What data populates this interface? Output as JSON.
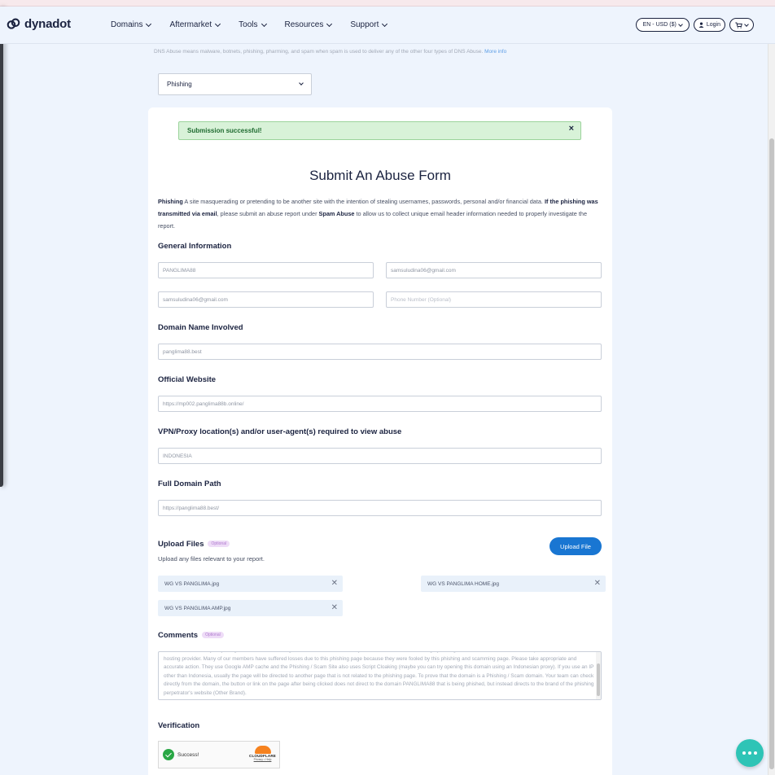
{
  "header": {
    "logo_text": "dynadot",
    "nav": [
      "Domains",
      "Aftermarket",
      "Tools",
      "Resources",
      "Support"
    ],
    "locale": "EN - USD ($)",
    "login": "Login"
  },
  "intro_note": "DNS Abuse means malware, botnets, phishing, pharming, and spam when spam is used to deliver any of the other four types of DNS Abuse.",
  "more_info": "More info",
  "abuse_type": "Phishing",
  "alert": {
    "text": "Submission successful!",
    "close": "×"
  },
  "form": {
    "title": "Submit An Abuse Form",
    "desc": {
      "term": "Phishing",
      "text1": " A site masquerading or pretending to be another site with the intention of stealing usernames, passwords, personal and/or financial data. ",
      "bold1": "If the phishing was transmitted via email",
      "text2": ", please submit an abuse report under ",
      "bold2": "Spam Abuse",
      "text3": " to allow us to collect unique email header information needed to properly investigate the report."
    },
    "general_info_label": "General Information",
    "name_value": "PANGLIMA88",
    "email_value": "samsuludina06@gmail.com",
    "email_confirm_value": "samsuludina06@gmail.com",
    "phone_placeholder": "Phone Number (Optional)",
    "domain_label": "Domain Name Involved",
    "domain_value": "panglima88.best",
    "website_label": "Official Website",
    "website_value": "https://mp002.panglima88b.online/",
    "vpn_label": "VPN/Proxy location(s) and/or user-agent(s) required to view abuse",
    "vpn_value": "INDONESIA",
    "path_label": "Full Domain Path",
    "path_value": "https://panglima88.best/",
    "upload_label": "Upload Files",
    "optional_badge": "Optional",
    "upload_hint": "Upload any files relevant to your report.",
    "upload_button": "Upload File",
    "files": [
      "WG VS PANGLIMA.jpg",
      "WG VS PANGLIMA HOME.jpg",
      "WG VS PANGLIMA AMP.jpg"
    ],
    "comments_label": "Comments",
    "comments_text": "brand which certainly very dangerous when the investigation is not done and can only redirect at random sites through your registration. We have been able to report this domain to the hosting provider. Many of our members have suffered losses due to this phishing page because they were fooled by this phishing and scamming page. Please take appropriate and accurate action. They use Google AMP cache and the Phishing / Scam Site also uses Script Cloaking (maybe you can try opening this domain using an Indonesian proxy). If you use an IP other than Indonesia, usually the page will be directed to another page that is not related to the phishing page. To prove that the domain is a Phishing / Scam domain. Your team can check directly from the domain, the button or link on the page after being clicked does not direct to the domain PANGLIMA88 that is being phished, but instead directs to the brand of the phishing perpetrator's website (Other Brand).",
    "verification_label": "Verification",
    "captcha": {
      "status": "Success!",
      "brand": "CLOUDFLARE",
      "links": "Privacy • Help"
    }
  }
}
